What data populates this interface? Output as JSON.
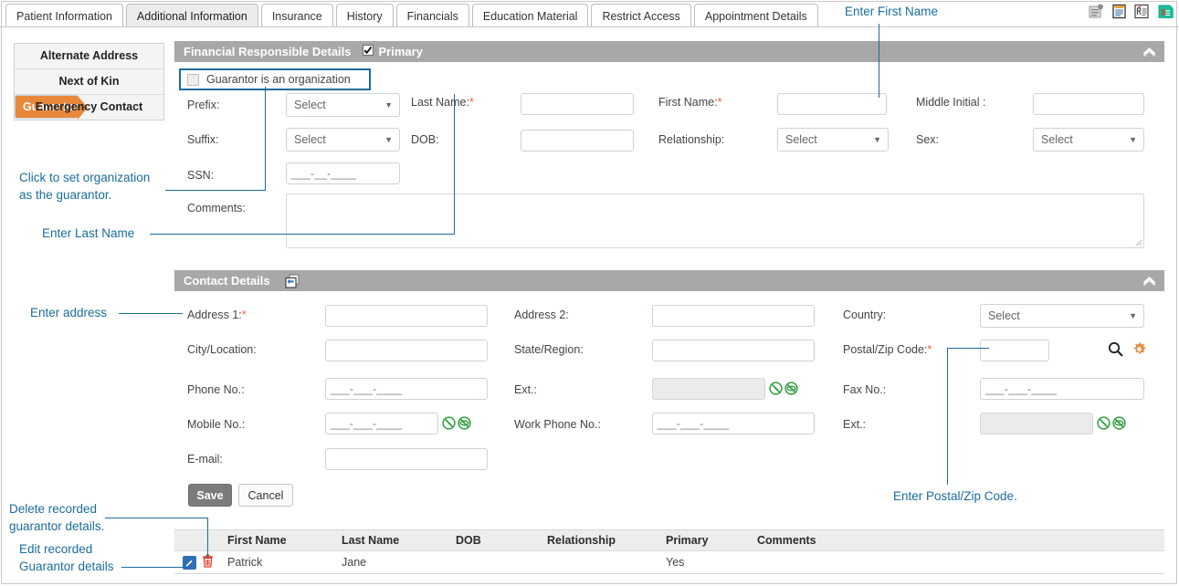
{
  "tabs": [
    {
      "label": "Patient Information",
      "active": false
    },
    {
      "label": "Additional Information",
      "active": true
    },
    {
      "label": "Insurance",
      "active": false
    },
    {
      "label": "History",
      "active": false
    },
    {
      "label": "Financials",
      "active": false
    },
    {
      "label": "Education Material",
      "active": false
    },
    {
      "label": "Restrict Access",
      "active": false
    },
    {
      "label": "Appointment Details",
      "active": false
    }
  ],
  "top_icons": [
    {
      "name": "notes-icon"
    },
    {
      "name": "clipboard-icon"
    },
    {
      "name": "prescription-icon"
    },
    {
      "name": "billing-icon"
    }
  ],
  "sidebar": {
    "items": [
      {
        "label": "Alternate Address",
        "selected": false
      },
      {
        "label": "Next of Kin",
        "selected": false
      },
      {
        "label": "Guarantor",
        "selected": true
      },
      {
        "label": "Emergency Contact",
        "selected": false
      }
    ]
  },
  "financial_panel": {
    "title": "Financial Responsible Details",
    "primary_label": "Primary",
    "primary_checked": true,
    "collapse_icon": "chevron-up-icon",
    "org_checkbox_label": "Guarantor is an organization",
    "org_checkbox_checked": false,
    "fields": {
      "prefix_label": "Prefix:",
      "prefix_value": "Select",
      "suffix_label": "Suffix:",
      "suffix_value": "Select",
      "ssn_label": "SSN:",
      "ssn_value": "___-__-____",
      "last_name_label": "Last Name:",
      "last_name_required": "*",
      "last_name_value": "",
      "dob_label": "DOB:",
      "dob_value": "",
      "first_name_label": "First Name:",
      "first_name_required": "*",
      "first_name_value": "",
      "relationship_label": "Relationship:",
      "relationship_value": "Select",
      "middle_initial_label": "Middle Initial :",
      "middle_initial_value": "",
      "sex_label": "Sex:",
      "sex_value": "Select",
      "comments_label": "Comments:",
      "comments_value": ""
    }
  },
  "contact_panel": {
    "title": "Contact Details",
    "copy_icon": "copy-address-icon",
    "collapse_icon": "chevron-up-icon",
    "fields": {
      "address1_label": "Address 1:",
      "address1_required": "*",
      "address1_value": "",
      "address2_label": "Address 2:",
      "address2_value": "",
      "country_label": "Country:",
      "country_value": "Select",
      "city_label": "City/Location:",
      "city_value": "",
      "state_label": "State/Region:",
      "state_value": "",
      "postal_label": "Postal/Zip Code:",
      "postal_required": "*",
      "postal_value": "",
      "phone_label": "Phone No.:",
      "phone_value": "___-___-____",
      "ext1_label": "Ext.:",
      "ext1_value": "",
      "fax_label": "Fax No.:",
      "fax_value": "___-___-____",
      "mobile_label": "Mobile No.:",
      "mobile_value": "___-___-____",
      "workphone_label": "Work Phone No.:",
      "workphone_value": "___-___-____",
      "ext2_label": "Ext.:",
      "ext2_value": "",
      "email_label": "E-mail:",
      "email_value": ""
    },
    "search_icon": "search-icon",
    "settings_icon": "gear-icon",
    "no_sms_icon": "no-sms-icon",
    "no_call_icon": "no-call-icon"
  },
  "actions": {
    "save_label": "Save",
    "cancel_label": "Cancel"
  },
  "table": {
    "columns": [
      "",
      "First Name",
      "Last Name",
      "DOB",
      "Relationship",
      "Primary",
      "Comments"
    ],
    "rows": [
      {
        "edit_icon": "edit-pencil-icon",
        "delete_icon": "delete-trash-icon",
        "first_name": "Patrick",
        "last_name": "Jane",
        "dob": "",
        "relationship": "",
        "primary": "Yes",
        "comments": ""
      }
    ]
  },
  "annotations": {
    "first_name": "Enter First Name",
    "organization": "Click to set organization\nas the guarantor.",
    "last_name": "Enter Last Name",
    "address": "Enter address",
    "postal": "Enter Postal/Zip Code.",
    "delete": "Delete recorded\nguarantor details.",
    "edit": "Edit recorded\nGuarantor details"
  },
  "colors": {
    "accent_orange": "#e8883a",
    "annotation_blue": "#1b6c9c",
    "panel_header_gray": "#a8a8a8",
    "required_red": "#e8603c",
    "icon_green": "#2e9e3e",
    "delete_red": "#e03b27",
    "edit_blue": "#2f6fb5"
  }
}
